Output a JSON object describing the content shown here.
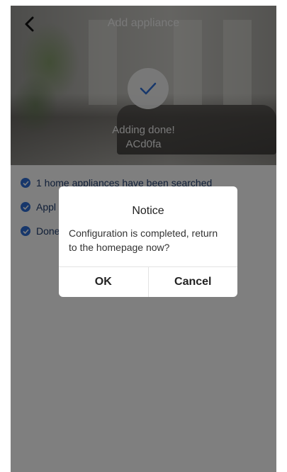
{
  "header": {
    "title": "Add appliance",
    "back_icon": "chevron-left-icon",
    "status_icon": "checkmark-icon",
    "done_line1": "Adding done!",
    "done_line2": "ACd0fa"
  },
  "steps": [
    {
      "label": "1 home appliances have been searched",
      "icon": "check-circle-icon"
    },
    {
      "label": "Appl",
      "icon": "check-circle-icon"
    },
    {
      "label": "Done",
      "icon": "check-circle-icon"
    }
  ],
  "dialog": {
    "title": "Notice",
    "message": "Configuration is completed, return to the homepage now?",
    "ok_label": "OK",
    "cancel_label": "Cancel"
  },
  "colors": {
    "accent": "#2f6fd6",
    "step_text": "#1f3c6e",
    "overlay": "rgba(0,0,0,0.5)"
  }
}
